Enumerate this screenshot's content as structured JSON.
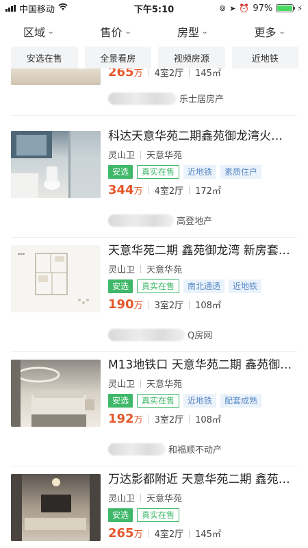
{
  "status_bar": {
    "carrier": "中国移动",
    "time": "下午5:10",
    "battery": "97%"
  },
  "filters": [
    {
      "label": "区域"
    },
    {
      "label": "售价"
    },
    {
      "label": "房型"
    },
    {
      "label": "更多"
    }
  ],
  "quick_tags": [
    "安选在售",
    "全景看房",
    "视频房源",
    "近地铁"
  ],
  "listings": [
    {
      "title": "",
      "location": [
        "",
        ""
      ],
      "tags": [],
      "price": "265",
      "price_unit": "万",
      "rooms": "4室2厅",
      "area": "145㎡",
      "agency": "乐士居房产"
    },
    {
      "title": "科达天意华苑二期鑫苑御龙湾火…",
      "location": [
        "灵山卫",
        "天意华苑"
      ],
      "tags": [
        "安选",
        "真实在售",
        "近地铁",
        "素质住户"
      ],
      "price": "344",
      "price_unit": "万",
      "rooms": "4室2厅",
      "area": "172㎡",
      "agency": "高登地产"
    },
    {
      "title": "天意华苑二期 鑫苑御龙湾 新房套…",
      "location": [
        "灵山卫",
        "天意华苑"
      ],
      "tags": [
        "安选",
        "真实在售",
        "南北通透",
        "近地铁"
      ],
      "price": "190",
      "price_unit": "万",
      "rooms": "3室2厅",
      "area": "108㎡",
      "agency": "Q房网"
    },
    {
      "title": "M13地铁口 天意华苑二期 鑫苑御…",
      "location": [
        "灵山卫",
        "天意华苑"
      ],
      "tags": [
        "安选",
        "真实在售",
        "近地铁",
        "配套成熟"
      ],
      "price": "192",
      "price_unit": "万",
      "rooms": "3室2厅",
      "area": "108㎡",
      "agency": "和福顺不动产"
    },
    {
      "title": "万达影都附近 天意华苑二期 鑫苑…",
      "location": [
        "灵山卫",
        "天意华苑"
      ],
      "tags": [
        "安选",
        "真实在售"
      ],
      "price": "265",
      "price_unit": "万",
      "rooms": "4室2厅",
      "area": "145㎡",
      "agency": ""
    }
  ],
  "colors": {
    "price": "#e4582c",
    "anxuan_green": "#3fb86a",
    "tag_blue": "#5b8ac6"
  }
}
